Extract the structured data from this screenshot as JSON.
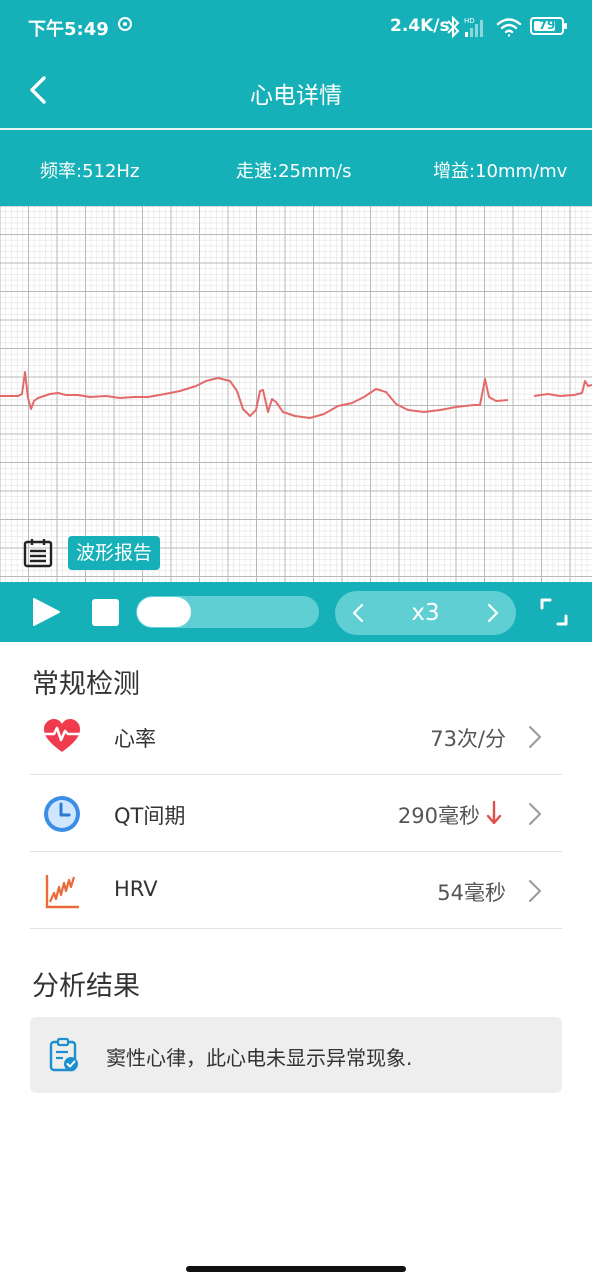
{
  "status_bar": {
    "time": "下午5:49",
    "network_speed": "2.4K/s",
    "battery_level": "79",
    "battery_fraction": 0.79,
    "icons": [
      "sync-icon",
      "bluetooth-icon",
      "hd-signal-icon",
      "wifi-icon",
      "battery-icon"
    ]
  },
  "header": {
    "title": "心电详情"
  },
  "params": {
    "frequency": "频率:512Hz",
    "speed": "走速:25mm/s",
    "gain": "增益:10mm/mv"
  },
  "ecg": {
    "report_label": "波形报告",
    "line_color": "#e46a6a",
    "grid_major_color": "#b9b9b9",
    "grid_minor_color": "#e3e3e3"
  },
  "playback": {
    "speed_label": "x3",
    "progress_fraction": 0.3
  },
  "routine": {
    "title": "常规检测",
    "items": [
      {
        "label": "心率",
        "value": "73次/分",
        "icon": "heart-rate-icon"
      },
      {
        "label": "QT间期",
        "value": "290毫秒",
        "icon": "clock-icon",
        "trend": "down"
      },
      {
        "label": "HRV",
        "value": "54毫秒",
        "icon": "hrv-chart-icon"
      }
    ]
  },
  "analysis": {
    "title": "分析结果",
    "result": "窦性心律，此心电未显示异常现象."
  },
  "colors": {
    "primary": "#15b0b8",
    "heart": "#ef3b4d",
    "trend_down": "#e0504a",
    "result_bg": "#eeeeee"
  }
}
